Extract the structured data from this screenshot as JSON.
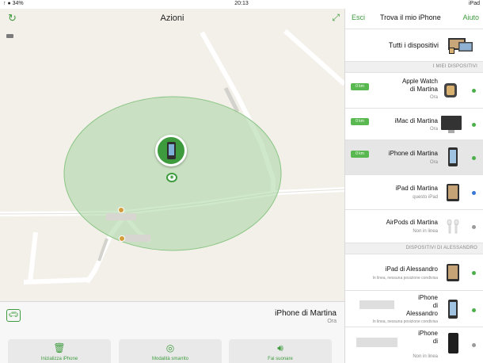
{
  "status": {
    "left": "↑ ● 34%",
    "time": "20:13",
    "right": "iPad"
  },
  "map": {
    "title": "Azioni"
  },
  "bottom": {
    "device_name": "iPhone di Martina",
    "device_sub": "Ora",
    "actions": [
      {
        "label": "Fai suonare"
      },
      {
        "label": "Modalità smarrito"
      },
      {
        "label": "Inizializza iPhone"
      }
    ]
  },
  "list": {
    "header": {
      "back": "Esci",
      "title": "Trova il mio iPhone",
      "help": "Aiuto"
    },
    "all_devices": "Tutti i dispositivi",
    "section_mine": "I MIEI DISPOSITIVI",
    "section_other": "DISPOSITIVI DI ALESSANDRO",
    "devices": [
      {
        "name_line1": "Apple Watch",
        "name_line2": "di Martina",
        "sub": "Ora",
        "distance": "0 km",
        "status_color": "#4cb04a",
        "icon": "apple-watch-icon"
      },
      {
        "name_line1": "iMac di Martina",
        "name_line2": "",
        "sub": "Ora",
        "distance": "0 km",
        "status_color": "#4cb04a",
        "icon": "imac-icon"
      },
      {
        "name_line1": "iPhone di Martina",
        "name_line2": "",
        "sub": "Ora",
        "distance": "0 km",
        "status_color": "#4cb04a",
        "icon": "iphone-icon"
      },
      {
        "name_line1": "iPad di Martina",
        "name_line2": "",
        "sub": "questo iPad",
        "distance": "",
        "status_color": "#3a78d6",
        "icon": "ipad-icon"
      },
      {
        "name_line1": "AirPods di Martina",
        "name_line2": "",
        "sub": "Non in linea",
        "distance": "",
        "status_color": "#9a9a9a",
        "icon": "airpods-icon"
      }
    ],
    "other_devices": [
      {
        "name_line1": "iPad di Alessandro",
        "name_line2": "",
        "sub": "In linea, nessuna posizione condivisa",
        "status_color": "#4cb04a",
        "icon": "ipad-icon"
      },
      {
        "name_line1": "iPhone",
        "name_line2": "di",
        "name_line3": "Alessandro",
        "sub": "In linea, nessuna posizione condivisa",
        "status_color": "#4cb04a",
        "icon": "iphone-icon"
      },
      {
        "name_line1": "iPhone",
        "name_line2": "di",
        "name_line3": "",
        "sub": "Non in linea",
        "status_color": "#9a9a9a",
        "icon": "iphone-icon"
      }
    ]
  },
  "colors": {
    "accent": "#3d9b3d",
    "badge": "#59b84f"
  }
}
